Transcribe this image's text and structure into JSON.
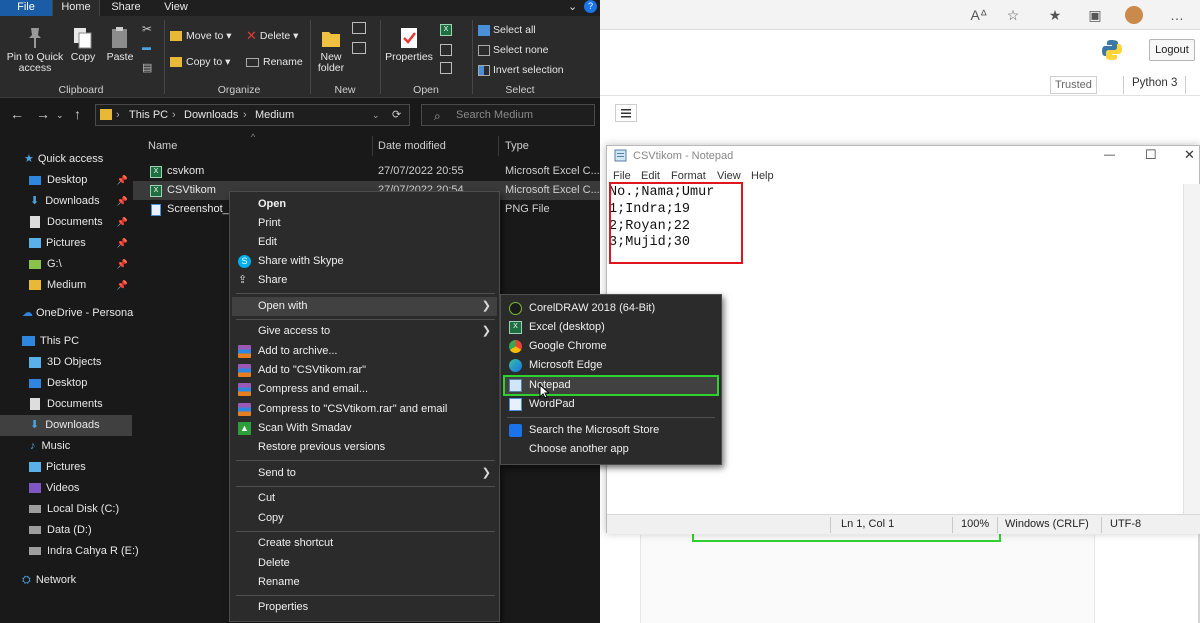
{
  "explorer": {
    "tabs": [
      "File",
      "Home",
      "Share",
      "View"
    ],
    "ribbon": {
      "clipboard": {
        "pin": "Pin to Quick access",
        "copy": "Copy",
        "paste": "Paste",
        "group": "Clipboard"
      },
      "organize": {
        "move_to": "Move to",
        "copy_to": "Copy to",
        "delete": "Delete",
        "rename": "Rename",
        "group": "Organize"
      },
      "new": {
        "new_folder": "New folder",
        "group": "New"
      },
      "open": {
        "properties": "Properties",
        "group": "Open"
      },
      "select": {
        "select_all": "Select all",
        "select_none": "Select none",
        "invert": "Invert selection",
        "group": "Select"
      }
    },
    "breadcrumb": [
      "This PC",
      "Downloads",
      "Medium"
    ],
    "search_placeholder": "Search Medium",
    "columns": {
      "name": "Name",
      "date": "Date modified",
      "type": "Type"
    },
    "files": [
      {
        "name": "csvkom",
        "date": "27/07/2022 20:55",
        "type": "Microsoft Excel C..."
      },
      {
        "name": "CSVtikom",
        "date": "27/07/2022 20:54",
        "type": "Microsoft Excel C..."
      },
      {
        "name": "Screenshot_3",
        "date": "",
        "type": "PNG File"
      }
    ],
    "nav": {
      "quick_access": "Quick access",
      "items": [
        "Desktop",
        "Downloads",
        "Documents",
        "Pictures",
        "G:\\",
        "Medium"
      ],
      "onedrive": "OneDrive - Persona",
      "this_pc": "This PC",
      "pc_items": [
        "3D Objects",
        "Desktop",
        "Documents",
        "Downloads",
        "Music",
        "Pictures",
        "Videos",
        "Local Disk (C:)",
        "Data (D:)",
        "Indra Cahya R (E:)"
      ],
      "network": "Network"
    }
  },
  "context_menu": {
    "open": "Open",
    "print": "Print",
    "edit": "Edit",
    "skype": "Share with Skype",
    "share": "Share",
    "open_with": "Open with",
    "give_access": "Give access to",
    "add_archive": "Add to archive...",
    "add_rar": "Add to \"CSVtikom.rar\"",
    "compress_email": "Compress and email...",
    "compress_rar_email": "Compress to \"CSVtikom.rar\" and email",
    "smadav": "Scan With Smadav",
    "restore": "Restore previous versions",
    "send_to": "Send to",
    "cut": "Cut",
    "copy": "Copy",
    "create_shortcut": "Create shortcut",
    "delete": "Delete",
    "rename": "Rename",
    "properties": "Properties"
  },
  "open_with_menu": {
    "corel": "CorelDRAW 2018 (64-Bit)",
    "excel": "Excel (desktop)",
    "chrome": "Google Chrome",
    "edge": "Microsoft Edge",
    "notepad": "Notepad",
    "wordpad": "WordPad",
    "store": "Search the Microsoft Store",
    "choose": "Choose another app"
  },
  "browser": {
    "logout": "Logout",
    "trusted": "Trusted",
    "kernel": "Python 3"
  },
  "notepad": {
    "title": "CSVtikom - Notepad",
    "menu": [
      "File",
      "Edit",
      "Format",
      "View",
      "Help"
    ],
    "content": "No.;Nama;Umur\n1;Indra;19\n2;Royan;22\n3;Mujid;30",
    "status": {
      "pos": "Ln 1, Col 1",
      "zoom": "100%",
      "eol": "Windows (CRLF)",
      "enc": "UTF-8"
    }
  },
  "colors": {
    "highlight_red": "#e0161c",
    "highlight_green": "#2fd12f",
    "file_tab": "#1a5da6"
  }
}
